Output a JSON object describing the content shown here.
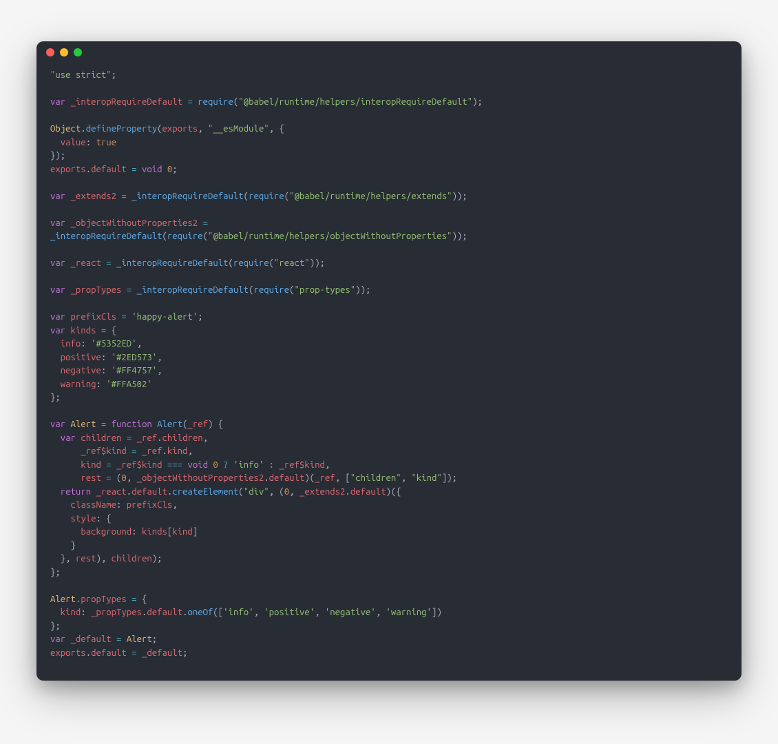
{
  "window": {
    "close": "close",
    "minimize": "minimize",
    "zoom": "zoom"
  },
  "code": {
    "t": {
      "useStrict": "\"use strict\"",
      "var": "var",
      "function": "function",
      "return": "return",
      "void": "void",
      "true": "true",
      "zero": "0",
      "Object": "Object",
      "defineProperty": "defineProperty",
      "exports": "exports",
      "require": "require",
      "default": "default",
      "createElement": "createElement",
      "oneOf": "oneOf",
      "propTypes": "propTypes",
      "value": "value",
      "children": "children",
      "kind": "kind",
      "kinds": "kinds",
      "rest": "rest",
      "className": "className",
      "style": "style",
      "background": "background",
      "info": "info",
      "positive": "positive",
      "negative": "negative",
      "warning": "warning",
      "prefixCls": "prefixCls",
      "Alert": "Alert",
      "_ref": "_ref",
      "_ref$kind": "_ref$kind",
      "_react": "_react",
      "_propTypes": "_propTypes",
      "_extends2": "_extends2",
      "_objectWithoutProperties2": "_objectWithoutProperties2",
      "_interopRequireDefault": "_interopRequireDefault",
      "_default": "_default"
    },
    "s": {
      "esModule": "\"__esModule\"",
      "interopPath": "\"@babel/runtime/helpers/interopRequireDefault\"",
      "extendsPath": "\"@babel/runtime/helpers/extends\"",
      "owpPath": "\"@babel/runtime/helpers/objectWithoutProperties\"",
      "reactPath": "\"react\"",
      "propTypesPath": "\"prop-types\"",
      "happyAlert": "'happy-alert'",
      "hexInfo": "'#5352ED'",
      "hexPositive": "'#2ED573'",
      "hexNegative": "'#FF4757'",
      "hexWarning": "'#FFA502'",
      "sInfo": "'info'",
      "sPositive": "'positive'",
      "sNegative": "'negative'",
      "sWarning": "'warning'",
      "sDiv": "\"div\"",
      "sChildren": "\"children\"",
      "sKind": "\"kind\""
    }
  }
}
